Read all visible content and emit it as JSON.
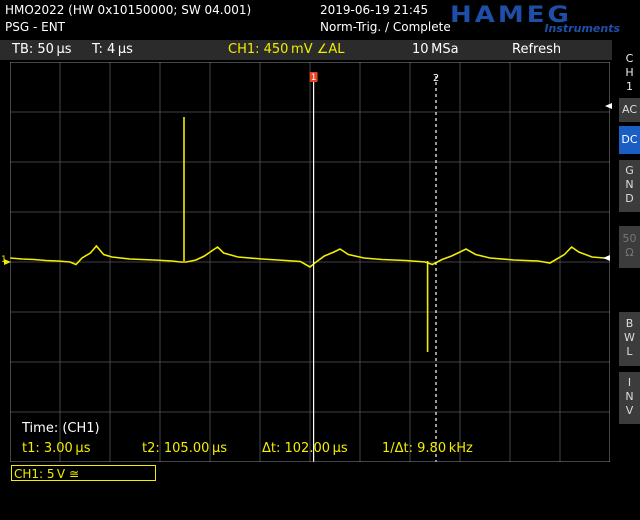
{
  "header": {
    "model": "HMO2022 (HW 0x10150000; SW 04.001)",
    "mode": "PSG - ENT",
    "datetime": "2019-06-19 21:45",
    "status": "Norm-Trig. / Complete"
  },
  "logo": {
    "brand": "HAMEG",
    "tagline": "Instruments"
  },
  "toolbar": {
    "timebase": "TB: 50 µs",
    "trigger_time": "T: 4 µs",
    "channel": "CH1: 450 mV ∠AL",
    "sample_rate": "10 MSa",
    "acq_mode": "Refresh"
  },
  "markers": {
    "cursor1": "1",
    "cursor2": "2",
    "ground_marker": "1"
  },
  "side_panel": {
    "channel": [
      "C",
      "H",
      "1"
    ],
    "ac": "AC",
    "dc": "DC",
    "gnd": [
      "G",
      "N",
      "D"
    ],
    "ohm": [
      "50",
      "Ω"
    ],
    "bwl": [
      "B",
      "W",
      "L"
    ],
    "inv": [
      "I",
      "N",
      "V"
    ]
  },
  "measurements": {
    "title": "Time: (CH1)",
    "t1": "t1: 3.00 µs",
    "t2": "t2: 105.00 µs",
    "dt": "Δt: 102.00 µs",
    "inv_dt": "1/Δt: 9.80 kHz"
  },
  "channel_setting": "CH1: 5 V ≅",
  "colors": {
    "trace": "#f1ee00",
    "accent": "#1a5ec4",
    "cursor1_marker": "#e8421e"
  },
  "chart_data": {
    "type": "line",
    "x_unit": "µs",
    "x_range": [
      -250,
      250
    ],
    "y_unit": "divisions",
    "y_range": [
      -4,
      4
    ],
    "cursor1_x": 3,
    "cursor2_x": 105,
    "spikes": [
      {
        "x": -105,
        "y": 2.9
      },
      {
        "x": 98,
        "y": -1.8
      }
    ],
    "trace": [
      [
        -250,
        0.08
      ],
      [
        -240,
        0.06
      ],
      [
        -230,
        0.05
      ],
      [
        -220,
        0.03
      ],
      [
        -210,
        0.02
      ],
      [
        -200,
        0.0
      ],
      [
        -195,
        -0.05
      ],
      [
        -190,
        0.08
      ],
      [
        -183,
        0.18
      ],
      [
        -178,
        0.32
      ],
      [
        -172,
        0.15
      ],
      [
        -165,
        0.1
      ],
      [
        -150,
        0.06
      ],
      [
        -130,
        0.04
      ],
      [
        -115,
        0.02
      ],
      [
        -108,
        0.0
      ],
      [
        -103,
        0.0
      ],
      [
        -95,
        0.04
      ],
      [
        -88,
        0.12
      ],
      [
        -82,
        0.22
      ],
      [
        -77,
        0.3
      ],
      [
        -72,
        0.18
      ],
      [
        -60,
        0.1
      ],
      [
        -40,
        0.06
      ],
      [
        -20,
        0.03
      ],
      [
        -8,
        0.01
      ],
      [
        0,
        -0.1
      ],
      [
        4,
        -0.02
      ],
      [
        12,
        0.12
      ],
      [
        20,
        0.2
      ],
      [
        25,
        0.26
      ],
      [
        32,
        0.15
      ],
      [
        45,
        0.08
      ],
      [
        60,
        0.05
      ],
      [
        80,
        0.03
      ],
      [
        96,
        0.0
      ],
      [
        102,
        -0.05
      ],
      [
        110,
        0.05
      ],
      [
        118,
        0.12
      ],
      [
        125,
        0.2
      ],
      [
        130,
        0.26
      ],
      [
        138,
        0.15
      ],
      [
        150,
        0.08
      ],
      [
        170,
        0.04
      ],
      [
        190,
        0.02
      ],
      [
        200,
        -0.02
      ],
      [
        205,
        0.05
      ],
      [
        212,
        0.15
      ],
      [
        218,
        0.3
      ],
      [
        224,
        0.2
      ],
      [
        235,
        0.1
      ],
      [
        250,
        0.07
      ]
    ]
  }
}
